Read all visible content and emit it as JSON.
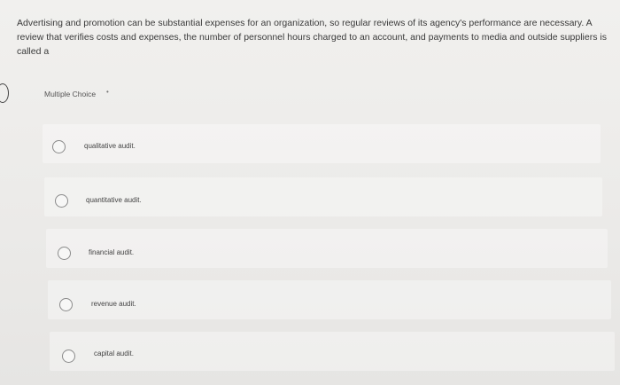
{
  "question": {
    "text": "Advertising and promotion can be substantial expenses for an organization, so regular reviews of its agency's performance are necessary. A review that verifies costs and expenses, the number of personnel hours charged to an account, and payments to media and outside suppliers is called a"
  },
  "multiple_choice": {
    "label": "Multiple Choice",
    "marker": "•"
  },
  "options": [
    {
      "label": "qualitative audit."
    },
    {
      "label": "quantitative audit."
    },
    {
      "label": "financial audit."
    },
    {
      "label": "revenue audit."
    },
    {
      "label": "capital audit."
    }
  ]
}
